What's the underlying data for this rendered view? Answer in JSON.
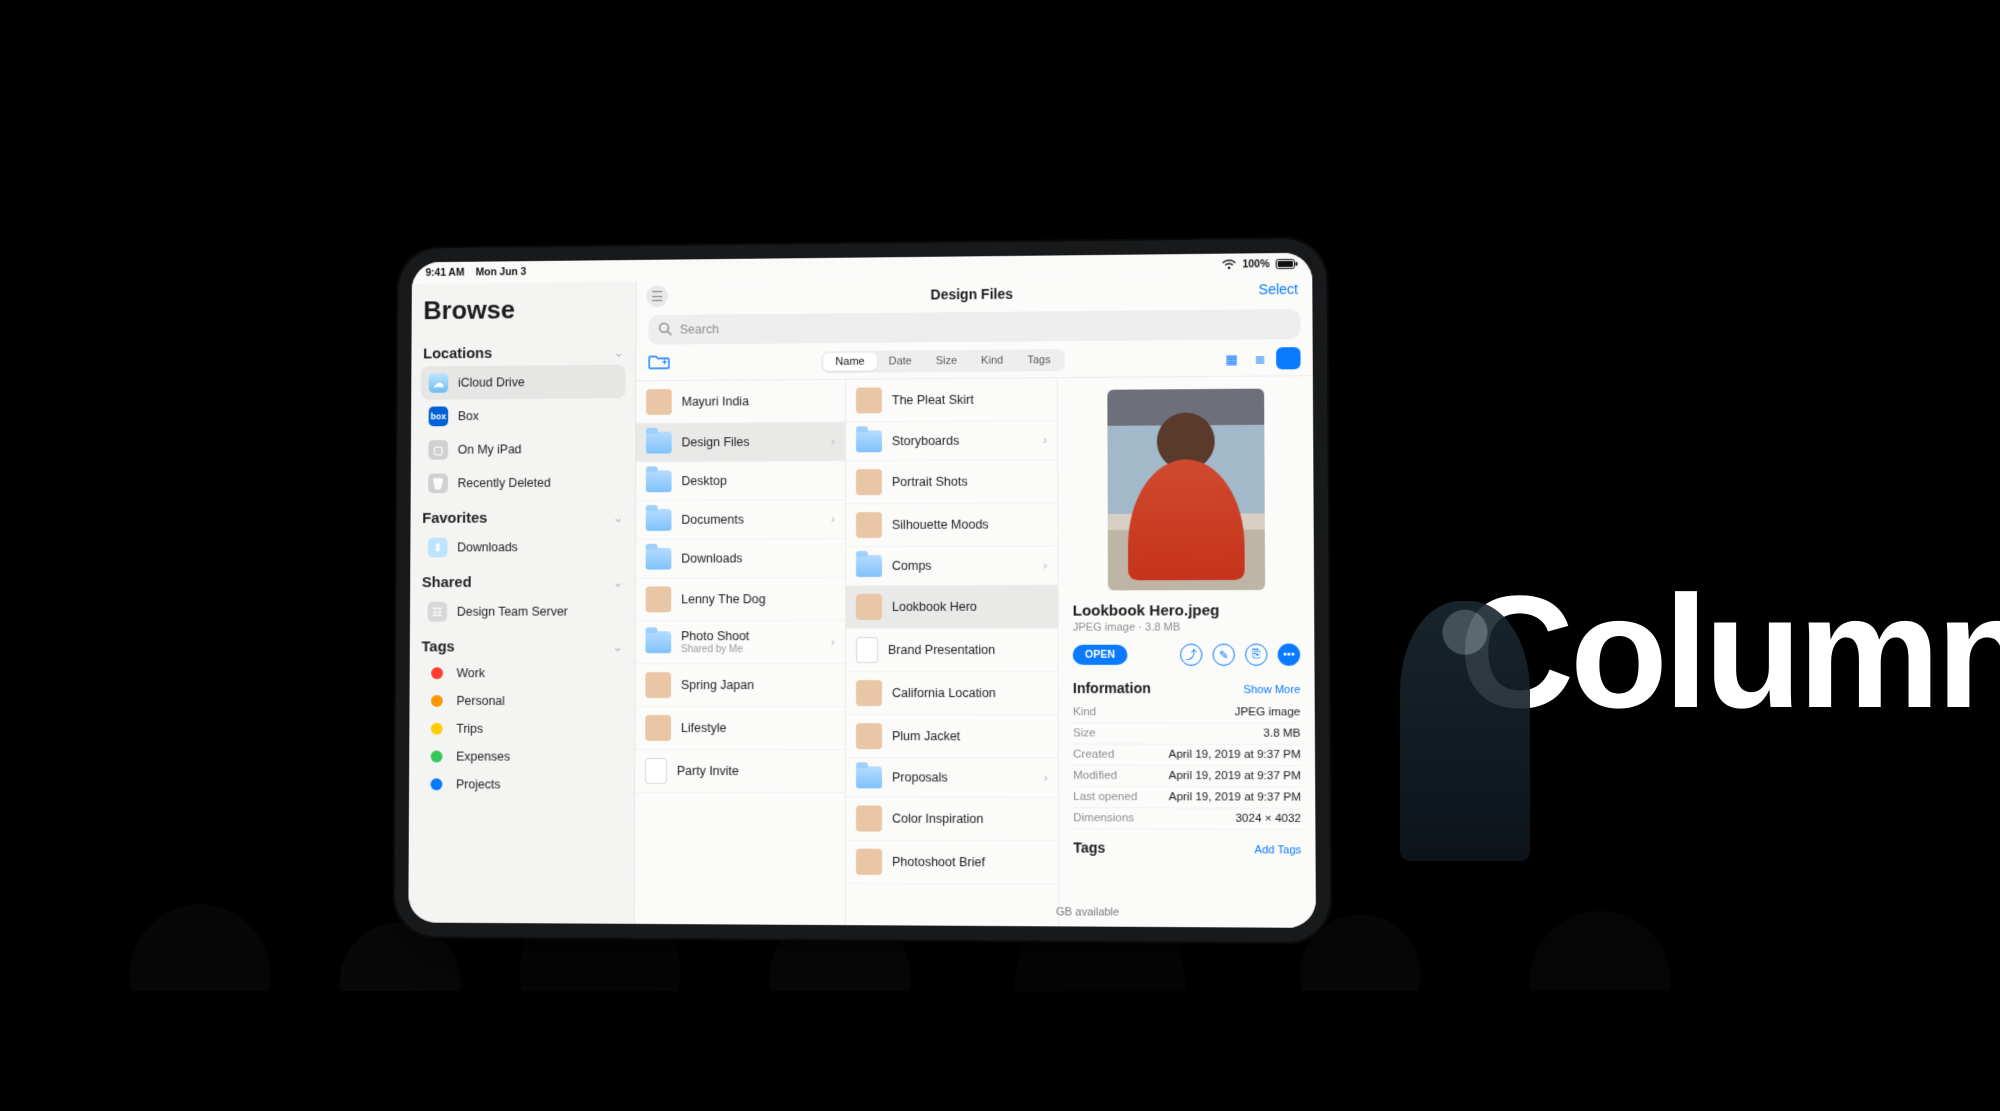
{
  "stage_text": "Column",
  "statusbar": {
    "time": "9:41 AM",
    "date": "Mon Jun 3",
    "battery": "100%"
  },
  "sidebar": {
    "title": "Browse",
    "sections": {
      "locations": {
        "title": "Locations",
        "items": [
          {
            "label": "iCloud Drive",
            "icon": "icloud",
            "selected": true
          },
          {
            "label": "Box",
            "icon": "box"
          },
          {
            "label": "On My iPad",
            "icon": "ipad"
          },
          {
            "label": "Recently Deleted",
            "icon": "trash"
          }
        ]
      },
      "favorites": {
        "title": "Favorites",
        "items": [
          {
            "label": "Downloads",
            "icon": "download"
          }
        ]
      },
      "shared": {
        "title": "Shared",
        "items": [
          {
            "label": "Design Team Server",
            "icon": "server"
          }
        ]
      },
      "tags": {
        "title": "Tags",
        "items": [
          {
            "label": "Work",
            "color": "red"
          },
          {
            "label": "Personal",
            "color": "orange"
          },
          {
            "label": "Trips",
            "color": "yellow"
          },
          {
            "label": "Expenses",
            "color": "green"
          },
          {
            "label": "Projects",
            "color": "blue"
          }
        ]
      }
    }
  },
  "header": {
    "title": "Design Files",
    "select_label": "Select",
    "search_placeholder": "Search"
  },
  "sort": {
    "options": [
      "Name",
      "Date",
      "Size",
      "Kind",
      "Tags"
    ],
    "active": "Name"
  },
  "columns": {
    "col1": [
      {
        "label": "Mayuri India",
        "type": "image"
      },
      {
        "label": "Design Files",
        "type": "folder",
        "selected": true,
        "disclosure": true
      },
      {
        "label": "Desktop",
        "type": "folder"
      },
      {
        "label": "Documents",
        "type": "folder",
        "disclosure": true
      },
      {
        "label": "Downloads",
        "type": "folder"
      },
      {
        "label": "Lenny The Dog",
        "type": "image"
      },
      {
        "label": "Photo Shoot",
        "sub": "Shared by Me",
        "type": "folder",
        "disclosure": true
      },
      {
        "label": "Spring Japan",
        "type": "image"
      },
      {
        "label": "Lifestyle",
        "type": "image"
      },
      {
        "label": "Party Invite",
        "type": "doc"
      }
    ],
    "col2": [
      {
        "label": "The Pleat Skirt",
        "type": "image"
      },
      {
        "label": "Storyboards",
        "type": "folder",
        "disclosure": true
      },
      {
        "label": "Portrait Shots",
        "type": "image"
      },
      {
        "label": "Silhouette Moods",
        "type": "image"
      },
      {
        "label": "Comps",
        "type": "folder",
        "disclosure": true
      },
      {
        "label": "Lookbook Hero",
        "type": "image",
        "selected": true
      },
      {
        "label": "Brand Presentation",
        "type": "doc"
      },
      {
        "label": "California Location",
        "type": "image"
      },
      {
        "label": "Plum Jacket",
        "type": "image"
      },
      {
        "label": "Proposals",
        "type": "folder",
        "disclosure": true
      },
      {
        "label": "Color Inspiration",
        "type": "image"
      },
      {
        "label": "Photoshoot Brief",
        "type": "image"
      }
    ]
  },
  "detail": {
    "filename": "Lookbook Hero.jpeg",
    "meta": "JPEG image · 3.8 MB",
    "open_label": "OPEN",
    "info_title": "Information",
    "show_more": "Show More",
    "kv": [
      {
        "k": "Kind",
        "v": "JPEG image"
      },
      {
        "k": "Size",
        "v": "3.8 MB"
      },
      {
        "k": "Created",
        "v": "April 19, 2019 at 9:37 PM"
      },
      {
        "k": "Modified",
        "v": "April 19, 2019 at 9:37 PM"
      },
      {
        "k": "Last opened",
        "v": "April 19, 2019 at 9:37 PM"
      },
      {
        "k": "Dimensions",
        "v": "3024 × 4032"
      }
    ],
    "tags_title": "Tags",
    "add_tags": "Add Tags"
  },
  "footer": {
    "available": "GB available"
  }
}
